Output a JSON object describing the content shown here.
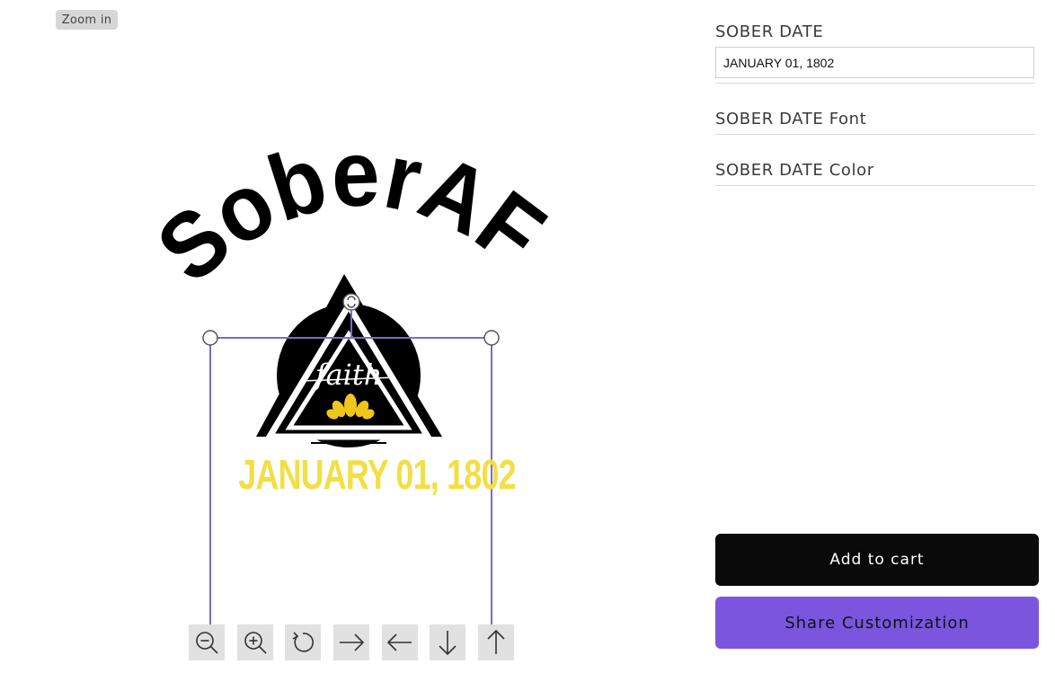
{
  "canvas": {
    "zoom_label": "Zoom in",
    "design": {
      "headline_text": "SoberAF",
      "emblem_word": "faith",
      "date_text": "JANUARY 01, 1802",
      "date_color": "#f1df45",
      "selection_color": "#7a6ad0"
    },
    "toolbar": [
      {
        "icon": "zoom-out-icon"
      },
      {
        "icon": "zoom-in-icon"
      },
      {
        "icon": "rotate-icon"
      },
      {
        "icon": "arrow-right-icon"
      },
      {
        "icon": "arrow-left-icon"
      },
      {
        "icon": "arrow-down-icon"
      },
      {
        "icon": "arrow-up-icon"
      }
    ]
  },
  "options": {
    "sober_date": {
      "label": "SOBER DATE",
      "value": "JANUARY 01, 1802"
    },
    "font": {
      "label": "SOBER DATE Font"
    },
    "color": {
      "label": "SOBER DATE Color"
    }
  },
  "actions": {
    "add_to_cart": "Add to cart",
    "share": "Share Customization"
  },
  "colors": {
    "cart_bg": "#0a0a0a",
    "share_bg": "#7b55de"
  }
}
